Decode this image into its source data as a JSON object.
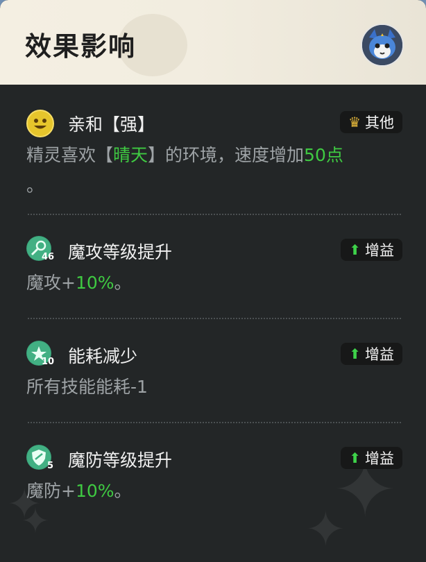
{
  "header": {
    "title": "效果影响"
  },
  "effects": [
    {
      "icon": "smile-face-icon",
      "name": "亲和【强】",
      "tag": {
        "icon": "crown-icon",
        "label": "其他"
      },
      "desc": {
        "pre": "精灵喜欢【",
        "highlight": "晴天",
        "mid": "】的环境，速度增加",
        "value": "50点",
        "post": "。"
      }
    },
    {
      "icon": "magic-attack-icon",
      "badge": "46",
      "name": "魔攻等级提升",
      "tag": {
        "icon": "up-arrow-icon",
        "label": "增益"
      },
      "desc": {
        "pre": "魔攻+",
        "value": "10%",
        "post": "。"
      }
    },
    {
      "icon": "energy-star-icon",
      "badge": "10",
      "name": "能耗减少",
      "tag": {
        "icon": "up-arrow-icon",
        "label": "增益"
      },
      "desc": {
        "text": "所有技能能耗-1"
      }
    },
    {
      "icon": "magic-defense-icon",
      "badge": "5",
      "name": "魔防等级提升",
      "tag": {
        "icon": "up-arrow-icon",
        "label": "增益"
      },
      "desc": {
        "pre": "魔防+",
        "value": "10%",
        "post": "。"
      }
    }
  ],
  "colors": {
    "panel_bg": "#232627",
    "header_bg": "#f4efe2",
    "highlight_green": "#3fca42",
    "desc_gray": "#9ea3a6"
  }
}
